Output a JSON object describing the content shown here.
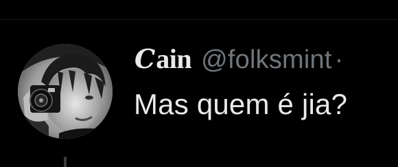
{
  "tweet": {
    "author": {
      "display_name_initial": "C",
      "display_name_rest": "ain",
      "handle": "@folksmint",
      "separator": "·",
      "avatar": "avatar-photo-person-with-camera"
    },
    "text": "Mas quem é jia?"
  },
  "colors": {
    "background": "#000000",
    "primary_text": "#e7e9ea",
    "secondary_text": "#71767b",
    "thread_line": "#3a3d40"
  }
}
